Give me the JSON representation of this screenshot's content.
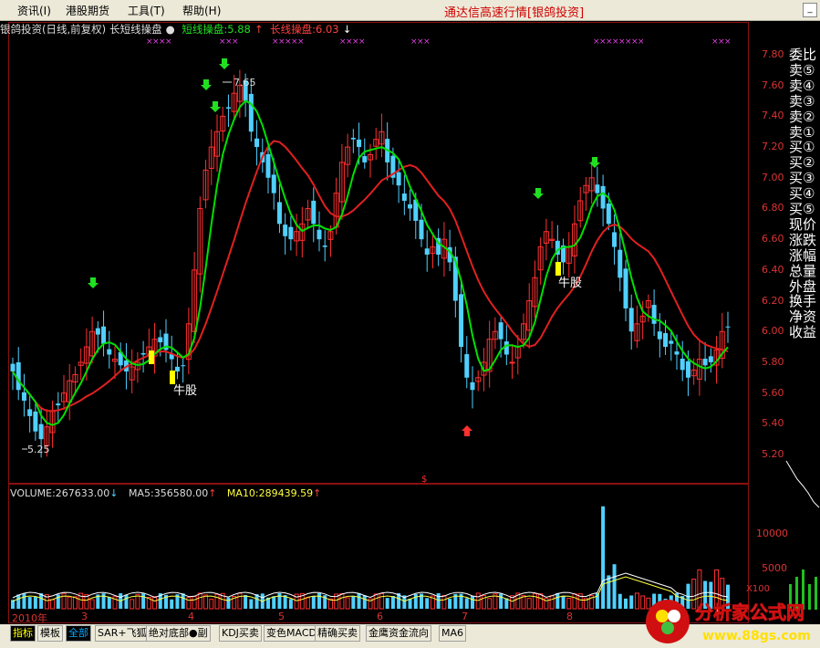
{
  "menu": {
    "items": [
      "资讯(I)",
      "港股期货",
      "工具(T)",
      "帮助(H)"
    ],
    "title": "通达信高速行情[银鸽投资]"
  },
  "info": {
    "stock": "银鸽投资(日线,前复权)",
    "indicator": "长短线操盘",
    "short_label": "短线操盘:5.88",
    "long_label": "长线操盘:6.03"
  },
  "price_axis": [
    "7.80",
    "7.60",
    "7.40",
    "7.20",
    "7.00",
    "6.80",
    "6.60",
    "6.40",
    "6.20",
    "6.00",
    "5.80",
    "5.60",
    "5.40",
    "5.20"
  ],
  "annotations": {
    "high": "7.65",
    "low": "5.25",
    "niu1": "牛股",
    "niu2": "牛股"
  },
  "volume": {
    "vol": "VOLUME:267633.00",
    "ma5": "MA5:356580.00",
    "ma10": "MA10:289439.59",
    "axis": [
      "10000",
      "5000"
    ],
    "axis_unit": "X100"
  },
  "dates": [
    "2010年",
    "3",
    "4",
    "5",
    "6",
    "7",
    "8"
  ],
  "right_panel": [
    "委比",
    "卖⑤",
    "卖④",
    "卖③",
    "卖②",
    "卖①",
    "买①",
    "买②",
    "买③",
    "买④",
    "买⑤",
    "现价",
    "涨跌",
    "涨幅",
    "总量",
    "外盘",
    "换手",
    "净资",
    "收益"
  ],
  "tabs": [
    "指标",
    "模板",
    "全部",
    "SAR+飞狐",
    "绝对底部●副",
    "KDJ买卖",
    "变色MACD",
    "精确买卖",
    "金鹰资金流向",
    "MA6"
  ],
  "watermark": {
    "line1": "分析家公式网",
    "line2": "www.88gs.com"
  },
  "colors": {
    "up": "#ff3030",
    "down": "#50d0ff",
    "short_line": "#00e000",
    "long_line": "#e02020",
    "signal_yellow": "#ffff00"
  },
  "chart_data": {
    "type": "candlestick",
    "title": "银鸽投资(日线,前复权)",
    "ylim": [
      5.1,
      7.9
    ],
    "close": [
      5.74,
      5.62,
      5.55,
      5.45,
      5.35,
      5.3,
      5.38,
      5.48,
      5.52,
      5.6,
      5.68,
      5.72,
      5.8,
      5.9,
      6.0,
      5.98,
      5.92,
      5.85,
      5.82,
      5.78,
      5.74,
      5.77,
      5.8,
      5.85,
      5.9,
      5.95,
      5.93,
      5.88,
      5.82,
      5.74,
      5.78,
      6.05,
      6.4,
      6.8,
      7.05,
      7.2,
      7.3,
      7.4,
      7.45,
      7.55,
      7.6,
      7.5,
      7.3,
      7.2,
      7.1,
      7.0,
      6.9,
      6.7,
      6.62,
      6.6,
      6.65,
      6.7,
      6.8,
      6.7,
      6.6,
      6.55,
      6.65,
      6.9,
      7.1,
      7.2,
      7.25,
      7.2,
      7.1,
      7.15,
      7.25,
      7.3,
      7.1,
      7.0,
      6.95,
      6.85,
      6.8,
      6.72,
      6.6,
      6.5,
      6.55,
      6.5,
      6.6,
      6.45,
      6.2,
      5.9,
      5.7,
      5.62,
      5.7,
      5.8,
      5.95,
      6.0,
      5.95,
      5.85,
      5.8,
      5.9,
      6.05,
      6.2,
      6.35,
      6.55,
      6.65,
      6.6,
      6.5,
      6.45,
      6.55,
      6.7,
      6.85,
      6.95,
      7.0,
      6.9,
      6.8,
      6.7,
      6.55,
      6.35,
      6.15,
      6.0,
      6.05,
      6.1,
      6.2,
      6.05,
      5.95,
      5.9,
      5.92,
      5.85,
      5.75,
      5.7,
      5.75,
      5.82,
      5.78,
      5.8,
      5.88,
      6.0,
      6.03
    ],
    "short_line": "green moving average (短线操盘)",
    "long_line": "red moving average (长线操盘)"
  }
}
